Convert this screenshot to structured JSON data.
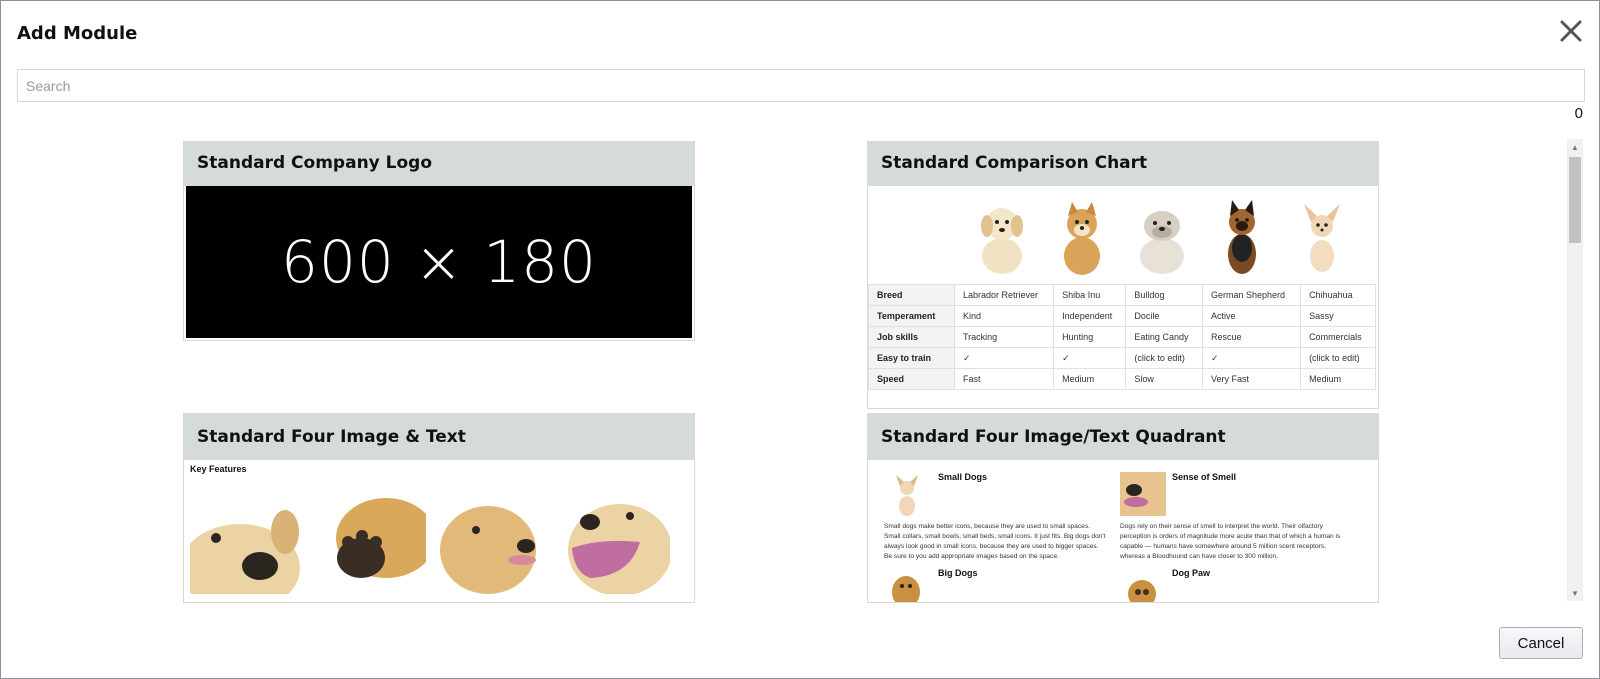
{
  "dialog": {
    "title": "Add Module",
    "close_icon": "close-icon",
    "search_placeholder": "Search",
    "count": "0",
    "cancel_label": "Cancel"
  },
  "modules": {
    "logo": {
      "title": "Standard Company Logo",
      "placeholder_text": "600 × 180"
    },
    "comparison": {
      "title": "Standard Comparison Chart",
      "table": [
        [
          "Breed",
          "Labrador Retriever",
          "Shiba Inu",
          "Bulldog",
          "German Shepherd",
          "Chihuahua"
        ],
        [
          "Temperament",
          "Kind",
          "Independent",
          "Docile",
          "Active",
          "Sassy"
        ],
        [
          "Job skills",
          "Tracking",
          "Hunting",
          "Eating Candy",
          "Rescue",
          "Commercials"
        ],
        [
          "Easy to train",
          "✓",
          "✓",
          "(click to edit)",
          "✓",
          "(click to edit)"
        ],
        [
          "Speed",
          "Fast",
          "Medium",
          "Slow",
          "Very Fast",
          "Medium"
        ]
      ]
    },
    "four_image": {
      "title": "Standard Four Image & Text",
      "heading": "Key Features"
    },
    "quadrant": {
      "title": "Standard Four Image/Text Quadrant",
      "items": [
        {
          "title": "Small Dogs",
          "text": "Small dogs make better icons, because they are used to small spaces. Small collars, small bowls, small beds, small icons. It just fits. Big dogs don't always look good in small icons, because they are used to bigger spaces. Be sure to you add appropriate images based on the space."
        },
        {
          "title": "Sense of Smell",
          "text": "Dogs rely on their sense of smell to interpret the world. Their olfactory perception is orders of magnitude more acute than that of which a human is capable — humans have somewhere around 5 million scent receptors, whereas a Bloodhound can have closer to 300 million."
        },
        {
          "title": "Big Dogs",
          "text": ""
        },
        {
          "title": "Dog Paw",
          "text": ""
        }
      ]
    }
  },
  "colors": {
    "card_header": "#d5dbdb",
    "border": "#d5d9d9",
    "dog_tan": "#d9a45a",
    "dog_cream": "#f1e2c4"
  }
}
